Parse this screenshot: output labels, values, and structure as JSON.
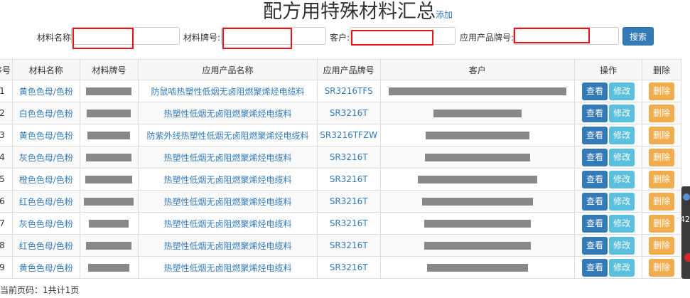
{
  "page": {
    "title": "配方用特殊材料汇总",
    "add_label": "添加"
  },
  "search": {
    "material_name_label": "材料名称",
    "material_grade_label": "材料牌号:",
    "customer_label": "客户:",
    "product_grade_label": "应用产品牌号:",
    "search_button": "搜索"
  },
  "table": {
    "headers": [
      "序号",
      "材料名称",
      "材料牌号",
      "应用产品名称",
      "应用产品牌号",
      "客户",
      "操作",
      "删除"
    ],
    "view_label": "查看",
    "edit_label": "修改",
    "delete_label": "删除",
    "rows": [
      {
        "no": "1",
        "name": "黄色色母/色粉",
        "product_name": "防鼠啮热塑性低烟无卤阻燃聚烯烃电缆料",
        "product_grade": "SR3216TFS"
      },
      {
        "no": "2",
        "name": "白色色母/色粉",
        "product_name": "热塑性低烟无卤阻燃聚烯烃电缆料",
        "product_grade": "SR3216T"
      },
      {
        "no": "3",
        "name": "黄色色母/色粉",
        "product_name": "防紫外线热塑性低烟无卤阻燃聚烯烃电缆料",
        "product_grade": "SR3216TFZW"
      },
      {
        "no": "4",
        "name": "灰色色母/色粉",
        "product_name": "热塑性低烟无卤阻燃聚烯烃电缆料",
        "product_grade": "SR3216T"
      },
      {
        "no": "5",
        "name": "橙色色母/色粉",
        "product_name": "热塑性低烟无卤阻燃聚烯烃电缆料",
        "product_grade": "SR3216T"
      },
      {
        "no": "6",
        "name": "红色色母/色粉",
        "product_name": "热塑性低烟无卤阻燃聚烯烃电缆料",
        "product_grade": "SR3216T"
      },
      {
        "no": "7",
        "name": "灰色色母/色粉",
        "product_name": "热塑性低烟无卤阻燃聚烯烃电缆料",
        "product_grade": "SR3216T"
      },
      {
        "no": "8",
        "name": "红色色母/色粉",
        "product_name": "热塑性低烟无卤阻燃聚烯烃电缆料",
        "product_grade": "SR3216T"
      },
      {
        "no": "9",
        "name": "黄色色母/色粉",
        "product_name": "热塑性低烟无卤阻燃聚烯烃电缆料",
        "product_grade": "SR3216T"
      }
    ]
  },
  "footer": {
    "pager_text": "当前页码：1共计1页"
  },
  "side": {
    "number": "42"
  },
  "colors": {
    "primary": "#337ab7",
    "info": "#5bc0de",
    "warning": "#f0ad4e",
    "highlight": "#e8121b"
  }
}
